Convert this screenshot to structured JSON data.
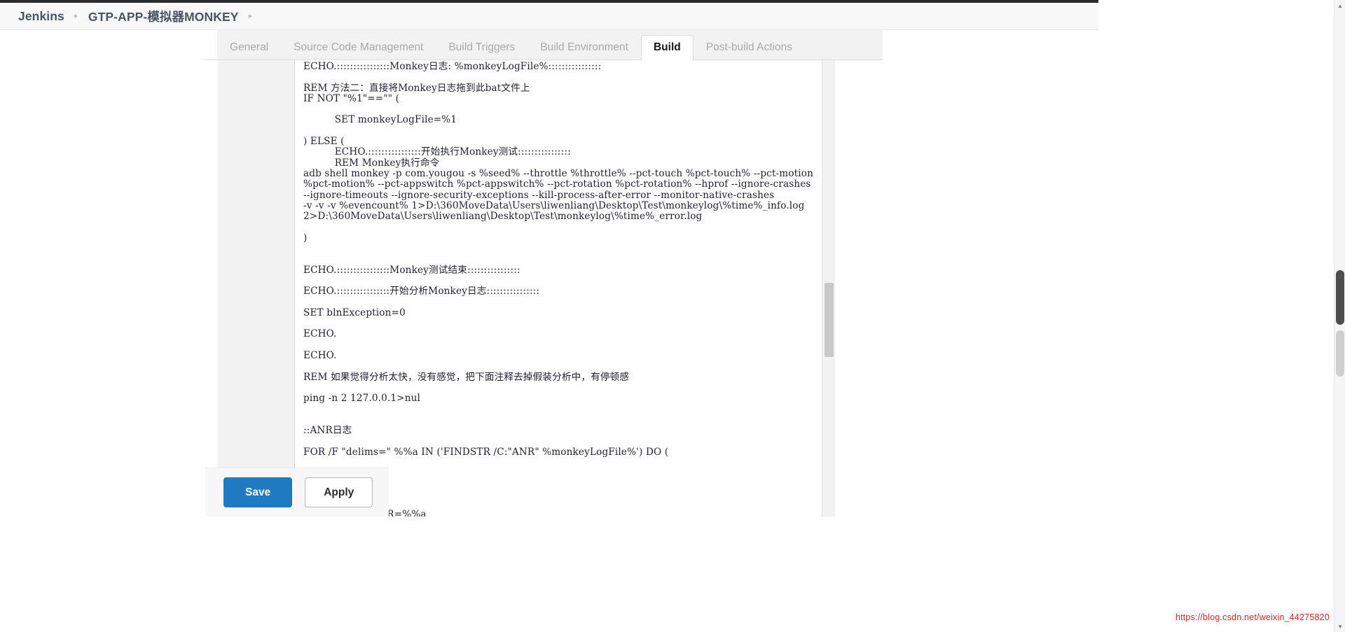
{
  "breadcrumb": {
    "items": [
      {
        "label": "Jenkins"
      },
      {
        "label": "GTP-APP-模拟器MONKEY"
      }
    ],
    "separator": "▸"
  },
  "tabs": [
    {
      "label": "General",
      "active": false
    },
    {
      "label": "Source Code Management",
      "active": false
    },
    {
      "label": "Build Triggers",
      "active": false
    },
    {
      "label": "Build Environment",
      "active": false
    },
    {
      "label": "Build",
      "active": true
    },
    {
      "label": "Post-build Actions",
      "active": false
    }
  ],
  "script": {
    "content": "ECHO.::::::::::::::::Monkey日志: %monkeyLogFile%::::::::::::::::\n\nREM 方法二：直接将Monkey日志拖到此bat文件上\nIF NOT \"%1\"==\"\" (\n\n          SET monkeyLogFile=%1\n\n) ELSE (\n          ECHO.::::::::::::::::开始执行Monkey测试::::::::::::::::\n          REM Monkey执行命令\nadb shell monkey -p com.yougou -s %seed% --throttle %throttle% --pct-touch %pct-touch% --pct-motion\n%pct-motion% --pct-appswitch %pct-appswitch% --pct-rotation %pct-rotation% --hprof --ignore-crashes\n--ignore-timeouts --ignore-security-exceptions --kill-process-after-error --monitor-native-crashes\n-v -v -v %evencount% 1>D:\\360MoveData\\Users\\liwenliang\\Desktop\\Test\\monkeylog\\%time%_info.log\n2>D:\\360MoveData\\Users\\liwenliang\\Desktop\\Test\\monkeylog\\%time%_error.log\n\n)\n\n\nECHO.::::::::::::::::Monkey测试结束::::::::::::::::\n\nECHO.::::::::::::::::开始分析Monkey日志::::::::::::::::\n\nSET blnException=0\n\nECHO.\n\nECHO.\n\nREM 如果觉得分析太快，没有感觉，把下面注释去掉假装分析中，有停顿感\n\nping -n 2 127.0.0.1>nul\n\n\n::ANR日志\n\nFOR /F \"delims=\" %%a IN ('FINDSTR /C:\"ANR\" %monkeyLogFile%') DO (",
    "ghost_line": "          SET strANR=%%a"
  },
  "actions": {
    "save_label": "Save",
    "apply_label": "Apply"
  },
  "watermark": {
    "text": "https://blog.csdn.net/weixin_44275820"
  },
  "icons": {
    "scroll_up": "▲",
    "scroll_down": "▼"
  },
  "colors": {
    "accent": "#1f7bc1",
    "watermark": "#d7232b",
    "breadcrumb_text": "#4a5560",
    "tab_inactive": "#a9a9a9"
  }
}
